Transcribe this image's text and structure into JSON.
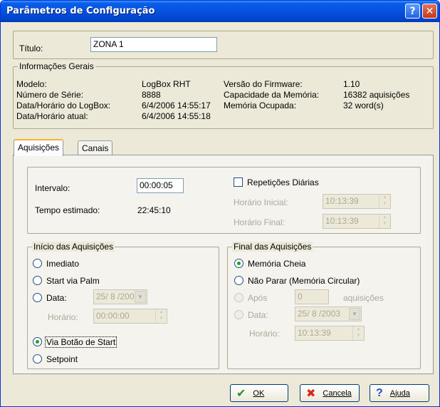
{
  "window": {
    "title": "Parâmetros de Configuração",
    "help_glyph": "?",
    "close_glyph": "✕"
  },
  "titulo": {
    "label": "Título:",
    "value": "ZONA 1"
  },
  "info": {
    "legend": "Informações Gerais",
    "modelo_label": "Modelo:",
    "modelo_value": "LogBox RHT",
    "serie_label": "Número de Série:",
    "serie_value": "8888",
    "datalogbox_label": "Data/Horário do LogBox:",
    "datalogbox_value": "6/4/2006 14:55:17",
    "dataatual_label": "Data/Horário atual:",
    "dataatual_value": "6/4/2006 14:55:18",
    "firmware_label": "Versão do Firmware:",
    "firmware_value": "1.10",
    "capacidade_label": "Capacidade da Memória:",
    "capacidade_value": "16382 aquisições",
    "ocupada_label": "Memória Ocupada:",
    "ocupada_value": "32 word(s)"
  },
  "tabs": [
    {
      "label": "Aquisições",
      "active": true
    },
    {
      "label": "Canais",
      "active": false
    }
  ],
  "intervalo": {
    "label": "Intervalo:",
    "value": "00:00:05",
    "tempo_label": "Tempo estimado:",
    "tempo_value": "22:45:10"
  },
  "repeticoes": {
    "label": "Repetições Diárias",
    "checked": false,
    "inicial_label": "Horário Inicial:",
    "inicial_value": "10:13:39",
    "final_label": "Horário Final:",
    "final_value": "10:13:39"
  },
  "inicio": {
    "legend": "Início das Aquisições",
    "options": [
      "Imediato",
      "Start via Palm",
      "Data:",
      "Via Botão de Start",
      "Setpoint"
    ],
    "selected": "Via Botão de Start",
    "data_value": "25/ 8 /2003",
    "horario_label": "Horário:",
    "horario_value": "00:00:00"
  },
  "final": {
    "legend": "Final das Aquisições",
    "options": [
      "Memória Cheia",
      "Não Parar (Memória Circular)",
      "Após",
      "Data:"
    ],
    "selected": "Memória Cheia",
    "apos_value": "0",
    "apos_suffix": "aquisições",
    "data_value": "25/ 8 /2003",
    "horario_label": "Horário:",
    "horario_value": "10:13:39"
  },
  "buttons": {
    "ok_label": "OK",
    "ok_icon": "✔",
    "cancela_label": "Cancela",
    "cancela_icon": "✖",
    "ajuda_label": "Ajuda",
    "ajuda_icon": "?"
  },
  "colors": {
    "titlebar": "#0551e0",
    "ok_icon": "#2e8b2e",
    "cancel_icon": "#d42a1c",
    "help_icon": "#1f4fc4",
    "tab_highlight": "#f8b32f"
  }
}
